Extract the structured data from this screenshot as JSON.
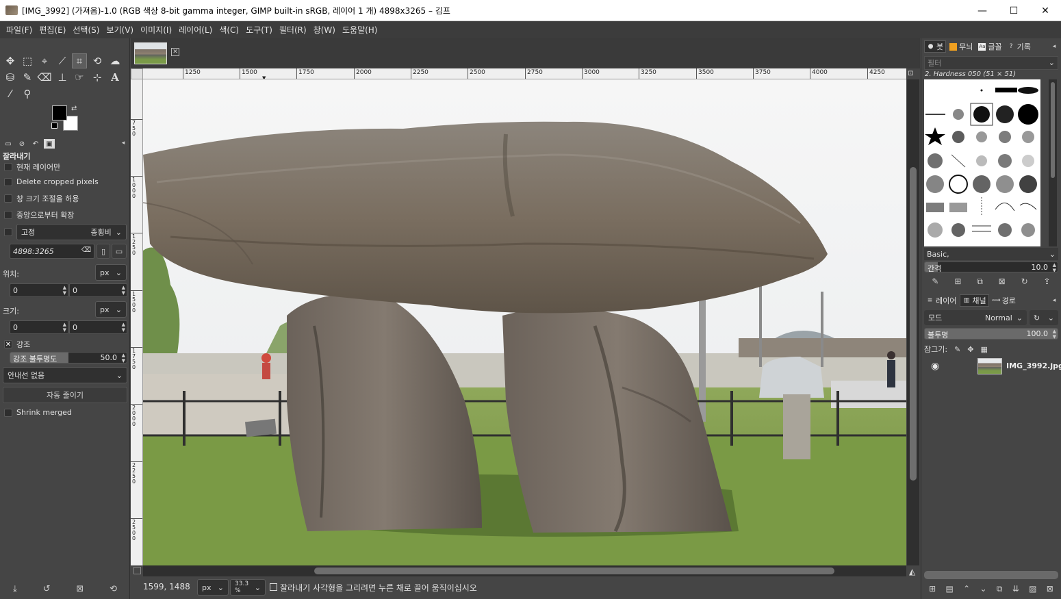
{
  "window": {
    "title": "[IMG_3992] (가져옴)-1.0 (RGB 색상 8-bit gamma integer, GIMP built-in sRGB, 레이어 1 개) 4898x3265 – 김프",
    "minimize": "—",
    "maximize": "☐",
    "close": "✕"
  },
  "menubar": [
    "파일(F)",
    "편집(E)",
    "선택(S)",
    "보기(V)",
    "이미지(I)",
    "레이어(L)",
    "색(C)",
    "도구(T)",
    "필터(R)",
    "창(W)",
    "도움말(H)"
  ],
  "toolbox": {
    "tools": [
      {
        "name": "move-tool-icon",
        "glyph": "✥"
      },
      {
        "name": "rect-select-icon",
        "glyph": "⬚"
      },
      {
        "name": "free-select-icon",
        "glyph": "⌖"
      },
      {
        "name": "fuzzy-select-icon",
        "glyph": "⟋"
      },
      {
        "name": "crop-tool-icon",
        "glyph": "⌗"
      },
      {
        "name": "transform-tool-icon",
        "glyph": "⟲"
      },
      {
        "name": "warp-tool-icon",
        "glyph": "☁"
      },
      {
        "name": "bucket-fill-icon",
        "glyph": "⛁"
      },
      {
        "name": "paintbrush-icon",
        "glyph": "✎"
      },
      {
        "name": "eraser-icon",
        "glyph": "⌫"
      },
      {
        "name": "clone-tool-icon",
        "glyph": "⊥"
      },
      {
        "name": "smudge-tool-icon",
        "glyph": "☞"
      },
      {
        "name": "paths-tool-icon",
        "glyph": "⊹"
      },
      {
        "name": "text-tool-icon",
        "glyph": "A"
      },
      {
        "name": "color-picker-icon",
        "glyph": "⁄"
      },
      {
        "name": "zoom-tool-icon",
        "glyph": "⚲"
      }
    ],
    "foreground_color": "#000000",
    "background_color": "#ffffff"
  },
  "tool_options": {
    "title": "잘라내기",
    "current_layer_only": "현재 레이어만",
    "delete_cropped": "Delete cropped pixels",
    "allow_growing": "창 크기 조절을 허용",
    "expand_from_center": "중앙으로부터 확장",
    "fixed_label": "고정",
    "fixed_mode": "종횡비",
    "ratio_value": "4898:3265",
    "position_label": "위치:",
    "position_unit": "px",
    "position_x": "0",
    "position_y": "0",
    "size_label": "크기:",
    "size_unit": "px",
    "size_w": "0",
    "size_h": "0",
    "highlight_label": "강조",
    "highlight_opacity_label": "강조 불투명도",
    "highlight_opacity_value": "50.0",
    "highlight_opacity_fraction": 0.5,
    "guides": "안내선 없음",
    "auto_shrink": "자동 줄이기",
    "shrink_merged": "Shrink merged"
  },
  "rulers": {
    "h_ticks": [
      "1250",
      "1500",
      "1750",
      "2000",
      "2250",
      "2500",
      "2750",
      "3000",
      "3250",
      "3500",
      "3750",
      "4000",
      "4250"
    ],
    "v_ticks": [
      "750",
      "1000",
      "1250",
      "1500",
      "1750",
      "2000",
      "2250",
      "2500",
      "2750"
    ]
  },
  "statusbar": {
    "coords": "1599, 1488",
    "unit": "px",
    "zoom": "33.3 %",
    "message": "잘라내기 사각형을 그리려면 누른 채로 끌어 움직이십시오"
  },
  "brushes_dock": {
    "tabs": [
      "붓",
      "무늬",
      "글꼴",
      "기록"
    ],
    "filter_placeholder": "필터",
    "brush_name": "2. Hardness 050 (51 × 51)",
    "tag": "Basic,",
    "spacing_label": "간격",
    "spacing_value": "10.0",
    "spacing_fraction": 0.1
  },
  "layers_dock": {
    "tabs": [
      "레이어",
      "채널",
      "경로"
    ],
    "mode_label": "모드",
    "mode_value": "Normal",
    "opacity_label": "불투명",
    "opacity_value": "100.0",
    "opacity_fraction": 1.0,
    "lock_label": "잠그기:",
    "layer_name": "IMG_3992.jpg"
  }
}
